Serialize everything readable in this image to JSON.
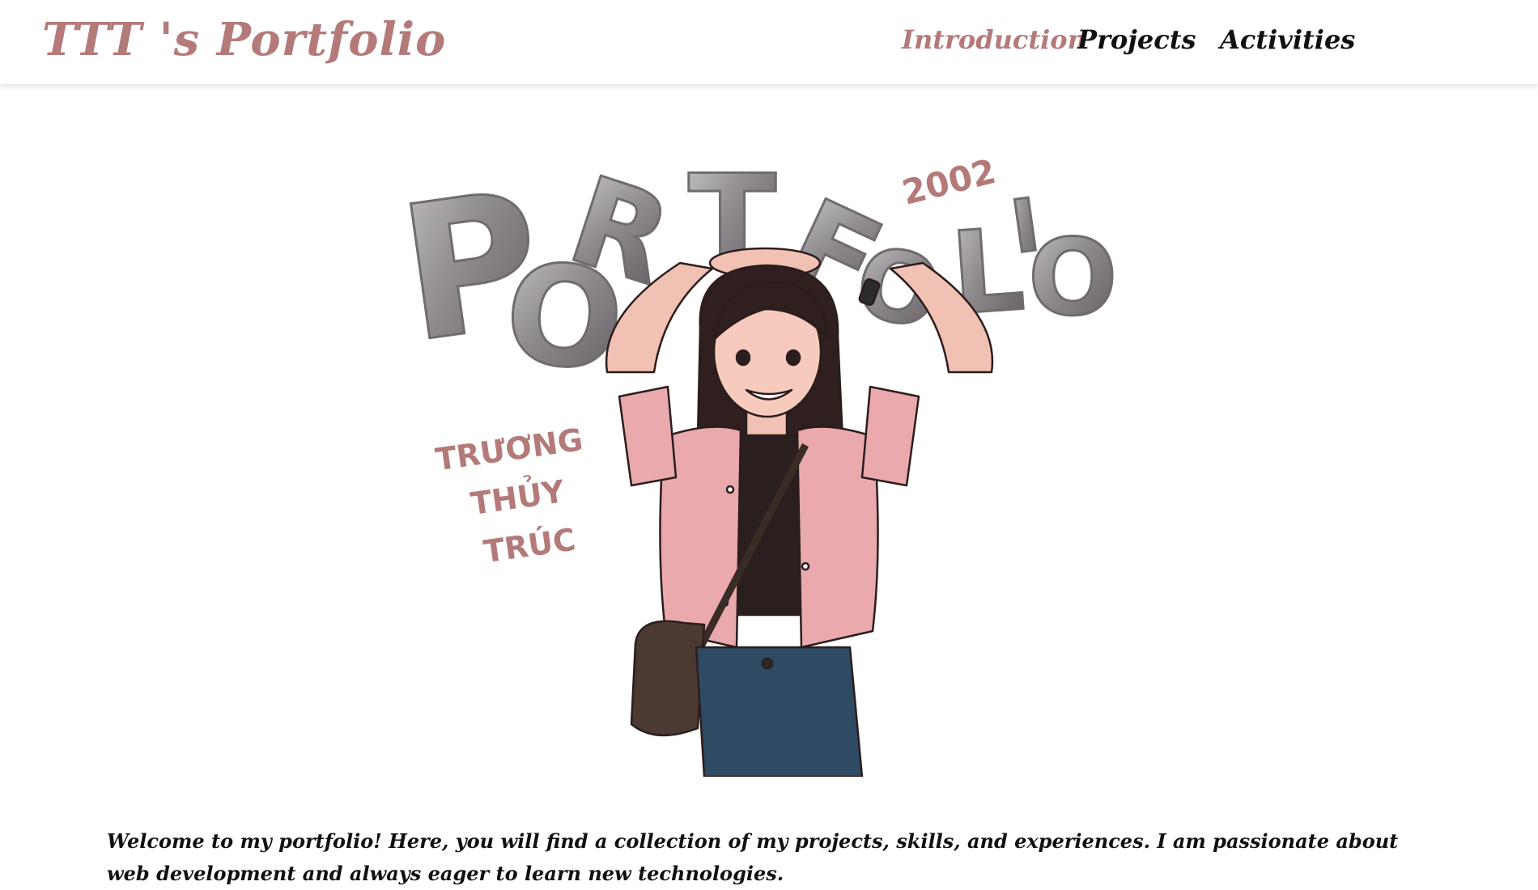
{
  "header": {
    "brand": "TTT 's Portfolio",
    "nav": [
      {
        "label": "Introduction",
        "active": true
      },
      {
        "label": "Projects",
        "active": false
      },
      {
        "label": "Activities",
        "active": false
      }
    ]
  },
  "hero": {
    "letters": [
      "P",
      "O",
      "R",
      "T",
      "F",
      "O",
      "L",
      "I",
      "O"
    ],
    "year": "2002",
    "name_lines": [
      "TRƯƠNG",
      "THỦY",
      "TRÚC"
    ]
  },
  "intro": {
    "text": "Welcome to my portfolio! Here, you will find a collection of my projects, skills, and experiences. I am passionate about web development and always eager to learn new technologies."
  },
  "colors": {
    "accent": "#b47a7a",
    "text": "#111111",
    "balloon": "#8f8c90",
    "shirt": "#e9a9ad",
    "jeans": "#2f4a63"
  }
}
